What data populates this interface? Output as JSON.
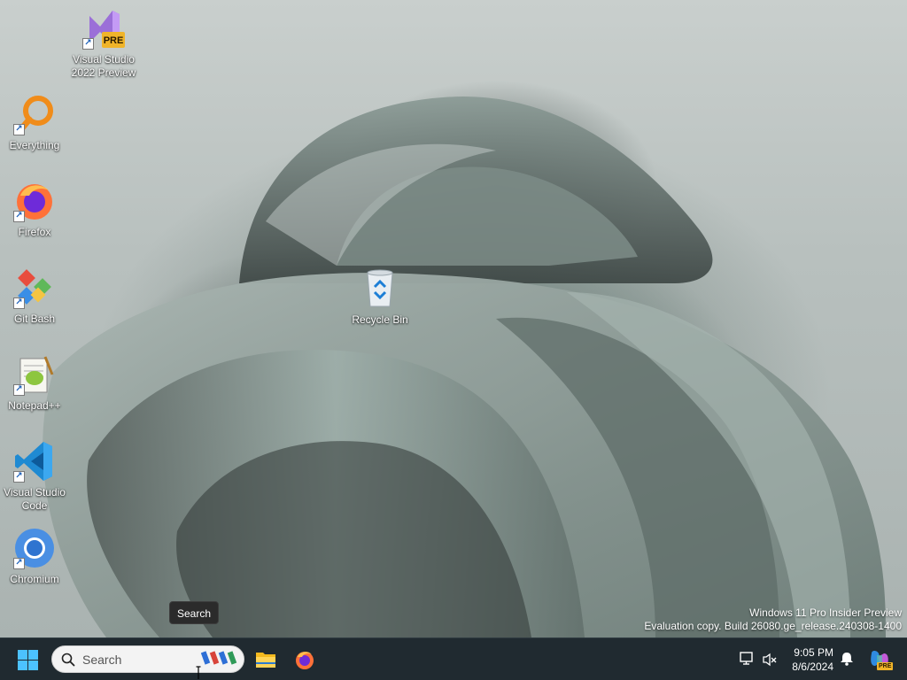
{
  "desktop": {
    "icons": [
      {
        "label": "Visual Studio 2022 Preview",
        "badge": "PRE",
        "icon": "visual-studio-preview-icon"
      },
      {
        "label": "Everything",
        "icon": "everything-search-icon"
      },
      {
        "label": "Firefox",
        "icon": "firefox-icon"
      },
      {
        "label": "Git Bash",
        "icon": "git-bash-icon"
      },
      {
        "label": "Notepad++",
        "icon": "notepad-plus-plus-icon"
      },
      {
        "label": "Visual Studio Code",
        "icon": "vscode-icon"
      },
      {
        "label": "Chromium",
        "icon": "chromium-icon"
      },
      {
        "label": "Recycle Bin",
        "icon": "recycle-bin-icon"
      }
    ]
  },
  "tooltip": {
    "text": "Search"
  },
  "watermark": {
    "line1": "Windows 11 Pro Insider Preview",
    "line2": "Evaluation copy. Build 26080.ge_release.240308-1400"
  },
  "taskbar": {
    "search_placeholder": "Search",
    "apps": [
      {
        "name": "File Explorer",
        "icon": "file-explorer-icon"
      },
      {
        "name": "Firefox",
        "icon": "firefox-icon"
      }
    ],
    "clock": {
      "time": "9:05 PM",
      "date": "8/6/2024"
    },
    "copilot_badge": "PRE",
    "colors": {
      "taskbar_bg": "#202a30",
      "accent": "#4cc2ff"
    }
  }
}
